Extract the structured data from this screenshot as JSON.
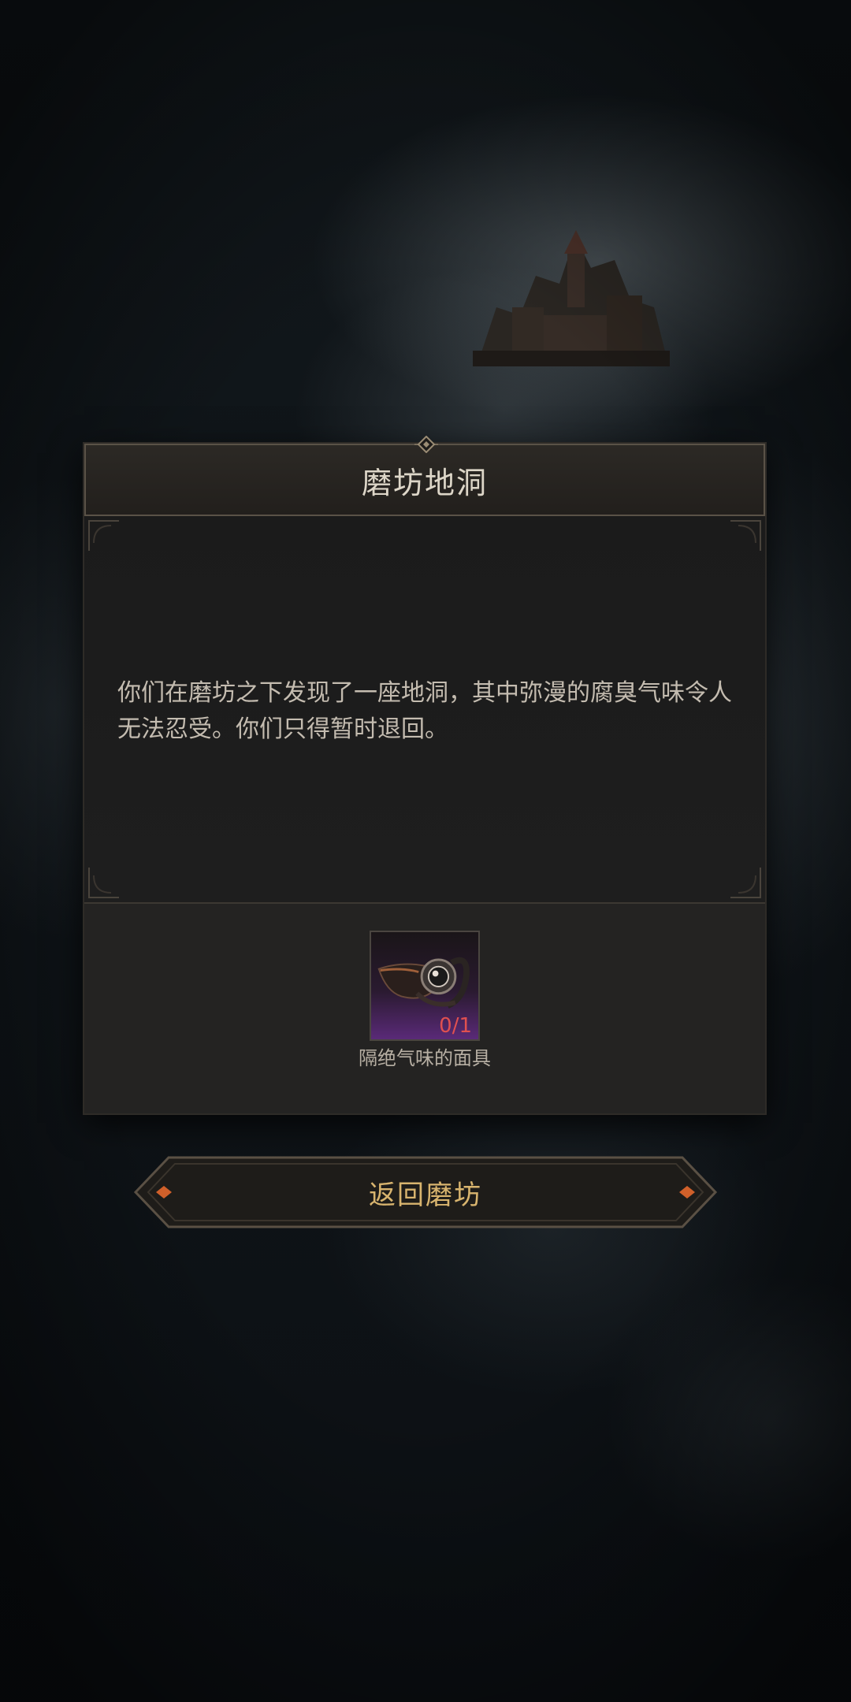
{
  "dialog": {
    "title": "磨坊地洞",
    "text": "你们在磨坊之下发现了一座地洞，其中弥漫的腐臭气味令人无法忍受。你们只得暂时退回。"
  },
  "required_item": {
    "name": "隔绝气味的面具",
    "count": "0/1",
    "icon": "plague-mask-icon",
    "rarity_color": "#5a2a78"
  },
  "actions": {
    "return_label": "返回磨坊"
  },
  "colors": {
    "title": "#ddd6c8",
    "body_text": "#c4bcb0",
    "button_text": "#d8b46e",
    "count_insufficient": "#e05050"
  }
}
